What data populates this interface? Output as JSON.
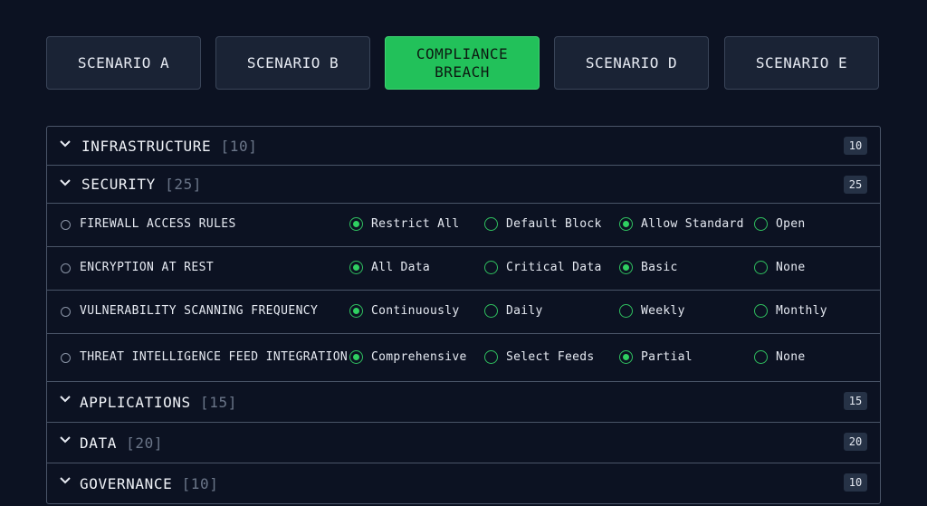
{
  "tabs": [
    {
      "label": "SCENARIO A",
      "active": false
    },
    {
      "label": "SCENARIO B",
      "active": false
    },
    {
      "label": "COMPLIANCE\nBREACH",
      "active": true
    },
    {
      "label": "SCENARIO D",
      "active": false
    },
    {
      "label": "SCENARIO E",
      "active": false
    }
  ],
  "sections": {
    "infrastructure": {
      "title": "INFRASTRUCTURE",
      "count": "[10]",
      "badge": "10",
      "expanded": false
    },
    "security": {
      "title": "SECURITY",
      "count": "[25]",
      "badge": "25",
      "expanded": true
    },
    "applications": {
      "title": "APPLICATIONS",
      "count": "[15]",
      "badge": "15",
      "expanded": false
    },
    "data": {
      "title": "DATA",
      "count": "[20]",
      "badge": "20",
      "expanded": false
    },
    "governance": {
      "title": "GOVERNANCE",
      "count": "[10]",
      "badge": "10",
      "expanded": false
    }
  },
  "security_rows": [
    {
      "label": "FIREWALL ACCESS RULES",
      "options": [
        {
          "label": "Restrict All",
          "selected": true
        },
        {
          "label": "Default Block",
          "selected": false
        },
        {
          "label": "Allow Standard",
          "selected": true
        },
        {
          "label": "Open",
          "selected": false
        }
      ]
    },
    {
      "label": "ENCRYPTION AT REST",
      "options": [
        {
          "label": "All Data",
          "selected": true
        },
        {
          "label": "Critical Data",
          "selected": false
        },
        {
          "label": "Basic",
          "selected": true
        },
        {
          "label": "None",
          "selected": false
        }
      ]
    },
    {
      "label": "VULNERABILITY SCANNING FREQUENCY",
      "options": [
        {
          "label": "Continuously",
          "selected": true
        },
        {
          "label": "Daily",
          "selected": false
        },
        {
          "label": "Weekly",
          "selected": false
        },
        {
          "label": "Monthly",
          "selected": false
        }
      ]
    },
    {
      "label": "THREAT INTELLIGENCE FEED INTEGRATION",
      "options": [
        {
          "label": "Comprehensive",
          "selected": true
        },
        {
          "label": "Select Feeds",
          "selected": false
        },
        {
          "label": "Partial",
          "selected": true
        },
        {
          "label": "None",
          "selected": false
        }
      ]
    }
  ],
  "colors": {
    "background": "#0c1222",
    "accent": "#22c15a",
    "radio": "#2fbf5f",
    "border": "#4a5568"
  },
  "icons": {
    "section_toggle": "chevron-down-icon",
    "row_marker": "circle-icon",
    "option": "radio-icon"
  }
}
